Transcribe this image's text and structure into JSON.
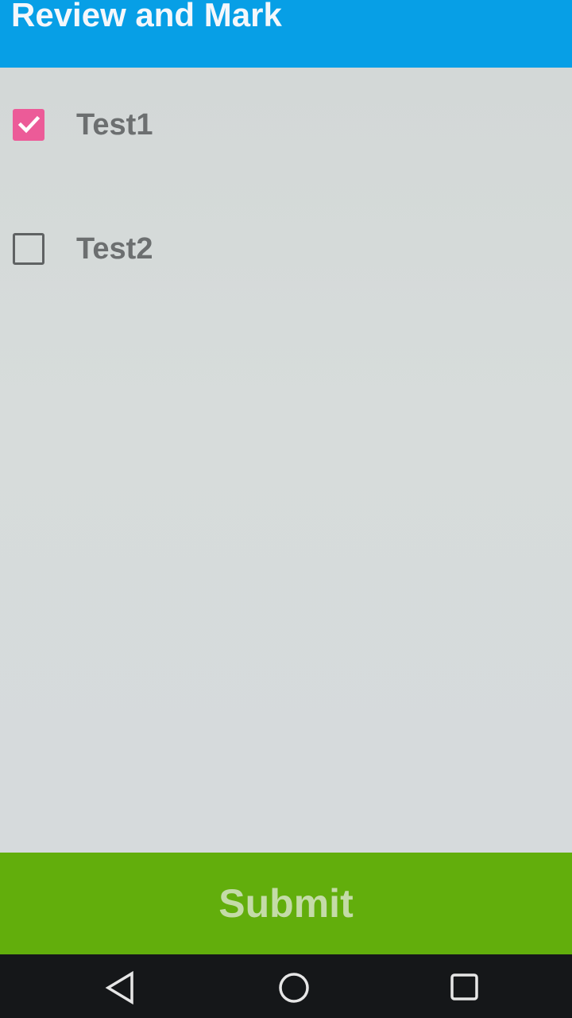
{
  "appbar": {
    "title": "Review and Mark",
    "color": "#079fe6"
  },
  "checklist": {
    "items": [
      {
        "label": "Test1",
        "checked": true
      },
      {
        "label": "Test2",
        "checked": false
      }
    ],
    "checked_color": "#ec5b98"
  },
  "submit": {
    "label": "Submit",
    "color": "#62ae0c"
  },
  "navbar": {
    "buttons": [
      "back-icon",
      "home-icon",
      "recents-icon"
    ]
  }
}
